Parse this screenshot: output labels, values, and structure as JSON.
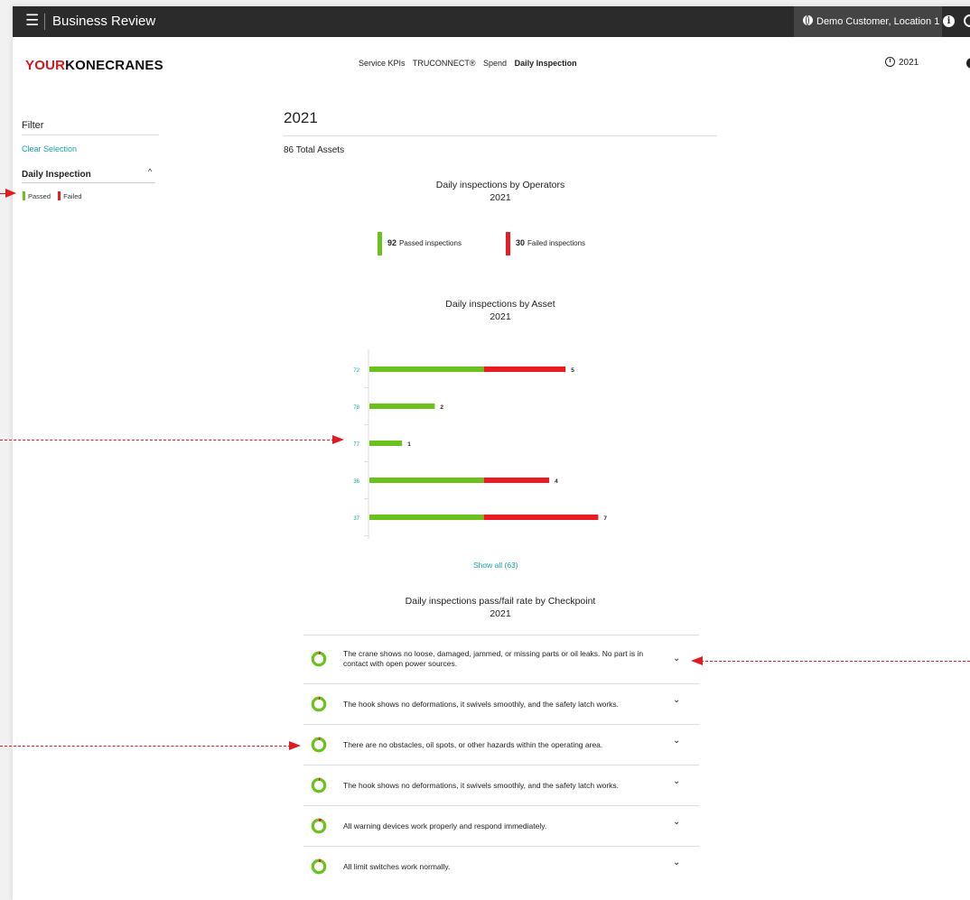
{
  "topbar": {
    "menu_icon": "hamburger-icon",
    "title": "Business Review",
    "customer": "Demo Customer, Location 1",
    "info_icon": "info-icon",
    "search_icon": "search-icon"
  },
  "header": {
    "brand_part1": "YOUR",
    "brand_part2": "KONECRANES",
    "nav": [
      "Service KPIs",
      "TRUCONNECT®",
      "Spend",
      "Daily Inspection"
    ],
    "active_nav": "Daily Inspection",
    "year": "2021"
  },
  "sidebar": {
    "filter_title": "Filter",
    "clear_selection": "Clear Selection",
    "section_title": "Daily Inspection",
    "legend": [
      {
        "label": "Passed",
        "color": "#6cc21c"
      },
      {
        "label": "Failed",
        "color": "#e81c22"
      }
    ]
  },
  "main": {
    "year_title": "2021",
    "total_assets": "86 Total Assets",
    "operators_chart": {
      "title": "Daily inspections by Operators",
      "subtitle": "2021",
      "passed_value": "92",
      "passed_label": "Passed inspections",
      "failed_value": "30",
      "failed_label": "Failed inspections"
    },
    "asset_chart_title": "Daily inspections by Asset",
    "asset_chart_subtitle": "2021",
    "show_all": "Show all (63)",
    "checkpoint_title": "Daily inspections pass/fail rate by Checkpoint",
    "checkpoint_subtitle": "2021",
    "checkpoints": [
      {
        "text": "The crane shows no loose, damaged, jammed, or missing parts or oil leaks. No part is in contact with open power sources.",
        "fail_rate": 0.04
      },
      {
        "text": "The hook shows no deformations, it swivels smoothly, and the safety latch works.",
        "fail_rate": 0.03
      },
      {
        "text": "There are no obstacles, oil spots, or other hazards within the operating area.",
        "fail_rate": 0.03
      },
      {
        "text": "The hook shows no deformations, it swivels smoothly, and the safety latch works.",
        "fail_rate": 0.03
      },
      {
        "text": "All warning devices work properly and respond immediately.",
        "fail_rate": 0.06
      },
      {
        "text": "All limit switches work normally.",
        "fail_rate": 0.05
      }
    ]
  },
  "colors": {
    "passed": "#6cc21c",
    "failed": "#e81c22",
    "link": "#18a3a8"
  },
  "chart_data": {
    "type": "bar",
    "orientation": "horizontal",
    "stacked": true,
    "title": "Daily inspections by Asset",
    "subtitle": "2021",
    "categories": [
      "72",
      "78",
      "77",
      "36",
      "37"
    ],
    "series": [
      {
        "name": "Passed",
        "values": [
          7,
          4,
          2,
          7,
          7
        ]
      },
      {
        "name": "Failed",
        "values": [
          5,
          0,
          0,
          4,
          7
        ]
      }
    ],
    "data_labels": [
      "5",
      "2",
      "1",
      "4",
      "7"
    ]
  }
}
